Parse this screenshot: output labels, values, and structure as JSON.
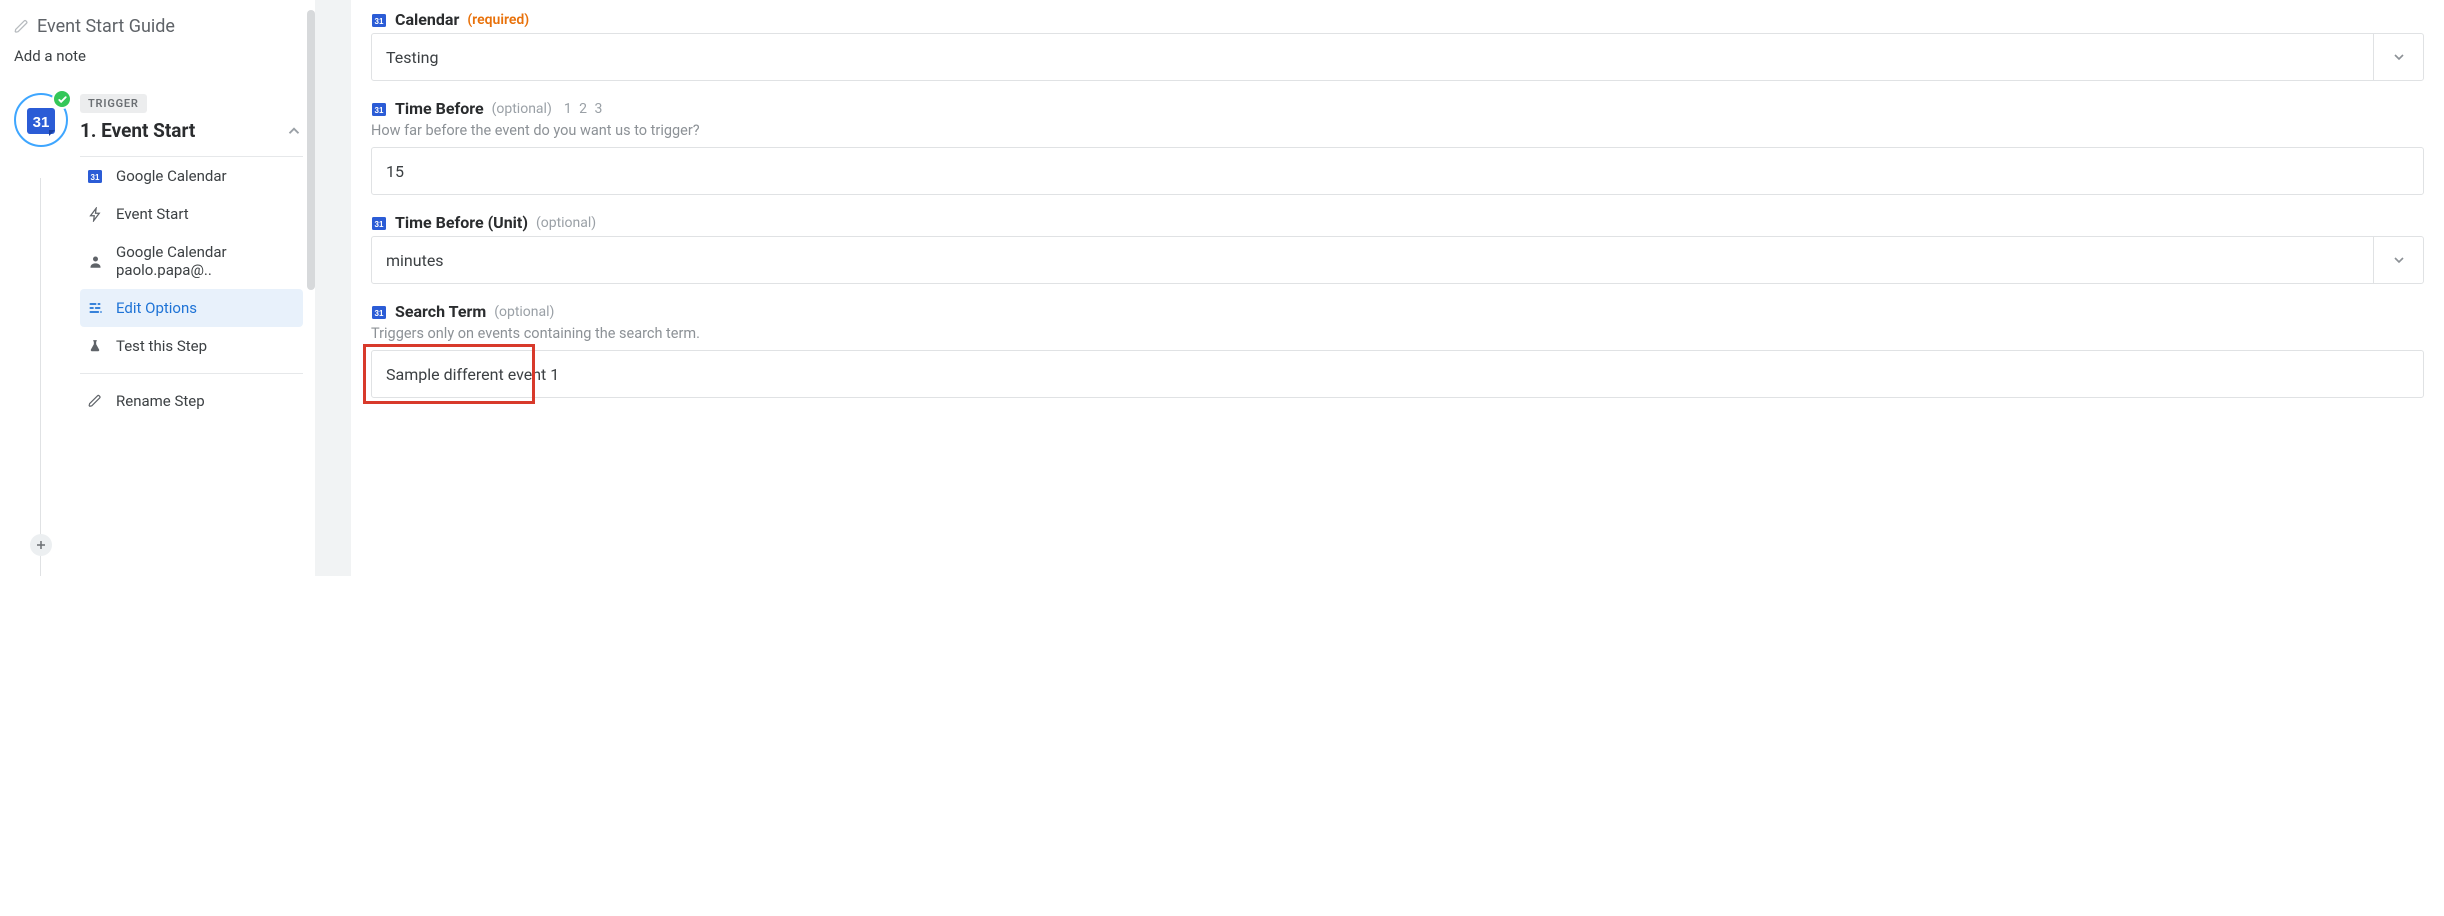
{
  "left": {
    "guide_title": "Event Start Guide",
    "add_note": "Add a note",
    "trigger_badge": "TRIGGER",
    "step_title": "1. Event Start",
    "sub": {
      "app": "Google Calendar",
      "trigger": "Event Start",
      "account": "Google Calendar paolo.papa@..",
      "edit": "Edit Options",
      "test": "Test this Step",
      "rename": "Rename Step"
    }
  },
  "fields": {
    "calendar": {
      "label": "Calendar",
      "tag": "(required)",
      "value": "Testing"
    },
    "time_before": {
      "label": "Time Before",
      "tag": "(optional)",
      "extra": "1 2 3",
      "help": "How far before the event do you want us to trigger?",
      "value": "15"
    },
    "time_before_unit": {
      "label": "Time Before (Unit)",
      "tag": "(optional)",
      "value": "minutes"
    },
    "search_term": {
      "label": "Search Term",
      "tag": "(optional)",
      "help": "Triggers only on events containing the search term.",
      "value": "Sample different event 1"
    }
  }
}
